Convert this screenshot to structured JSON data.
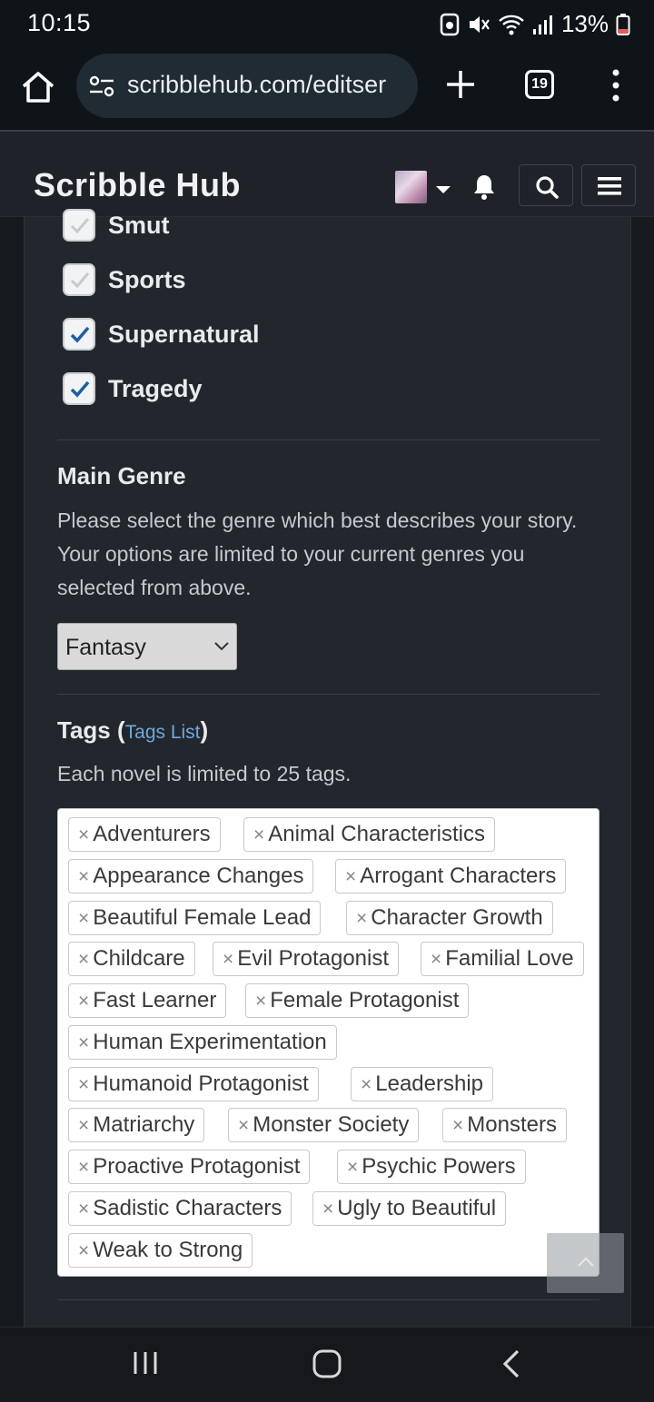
{
  "status": {
    "time": "10:15",
    "battery": "13%"
  },
  "browser": {
    "url": "scribblehub.com/editser",
    "tab_count": "19"
  },
  "site": {
    "title": "Scribble Hub"
  },
  "genres": [
    {
      "label": "Smut",
      "checked": false
    },
    {
      "label": "Sports",
      "checked": false
    },
    {
      "label": "Supernatural",
      "checked": true
    },
    {
      "label": "Tragedy",
      "checked": true
    }
  ],
  "main_genre": {
    "title": "Main Genre",
    "description": "Please select the genre which best describes your story. Your options are limited to your current genres you selected from above.",
    "selected": "Fantasy"
  },
  "tags": {
    "title": "Tags (",
    "link": "Tags List",
    "title_end": ")",
    "note": "Each novel is limited to 25 tags.",
    "items": [
      "Adventurers",
      "Animal Characteristics",
      "Appearance Changes",
      "Arrogant Characters",
      "Beautiful Female Lead",
      "Character Growth",
      "Childcare",
      "Evil Protagonist",
      "Familial Love",
      "Fast Learner",
      "Female Protagonist",
      "Human Experimentation",
      "Humanoid Protagonist",
      "Leadership",
      "Matriarchy",
      "Monster Society",
      "Monsters",
      "Proactive Protagonist",
      "Psychic Powers",
      "Sadistic Characters",
      "Ugly to Beautiful",
      "Weak to Strong"
    ],
    "remove_glyph": "×"
  }
}
